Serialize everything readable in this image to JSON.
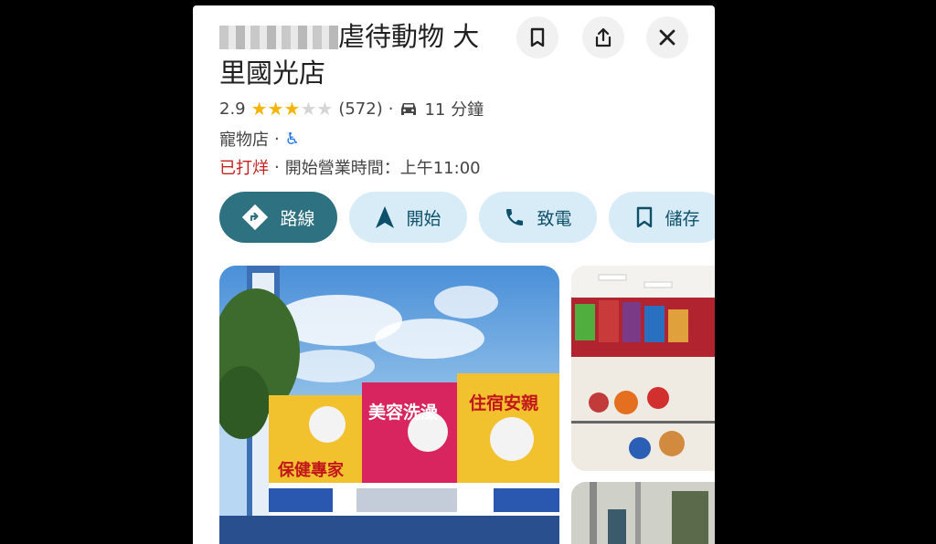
{
  "place": {
    "title_line1": "虐待動物 大",
    "title_line2": "里國光店",
    "rating": "2.9",
    "stars_filled": 3,
    "review_count": "(572)",
    "drive_time": "11 分鐘",
    "category": "寵物店",
    "status_closed": "已打烊",
    "hours": "開始營業時間：上午11:00"
  },
  "header_buttons": {
    "bookmark_icon": "bookmark-icon",
    "share_icon": "share-icon",
    "close_icon": "close-icon"
  },
  "actions": [
    {
      "label": "路線",
      "icon": "directions-icon"
    },
    {
      "label": "開始",
      "icon": "navigation-arrow-icon"
    },
    {
      "label": "致電",
      "icon": "phone-icon"
    },
    {
      "label": "儲存",
      "icon": "bookmark-icon"
    }
  ],
  "photo_signs": {
    "left": "保健專家",
    "middle": "美容洗澡",
    "right": "住宿安親"
  },
  "colors": {
    "primary_button": "#2e7180",
    "secondary_button": "#d7ecf6",
    "closed_red": "#c5221f",
    "star": "#f4b400",
    "accessibility_blue": "#1a73e8"
  }
}
